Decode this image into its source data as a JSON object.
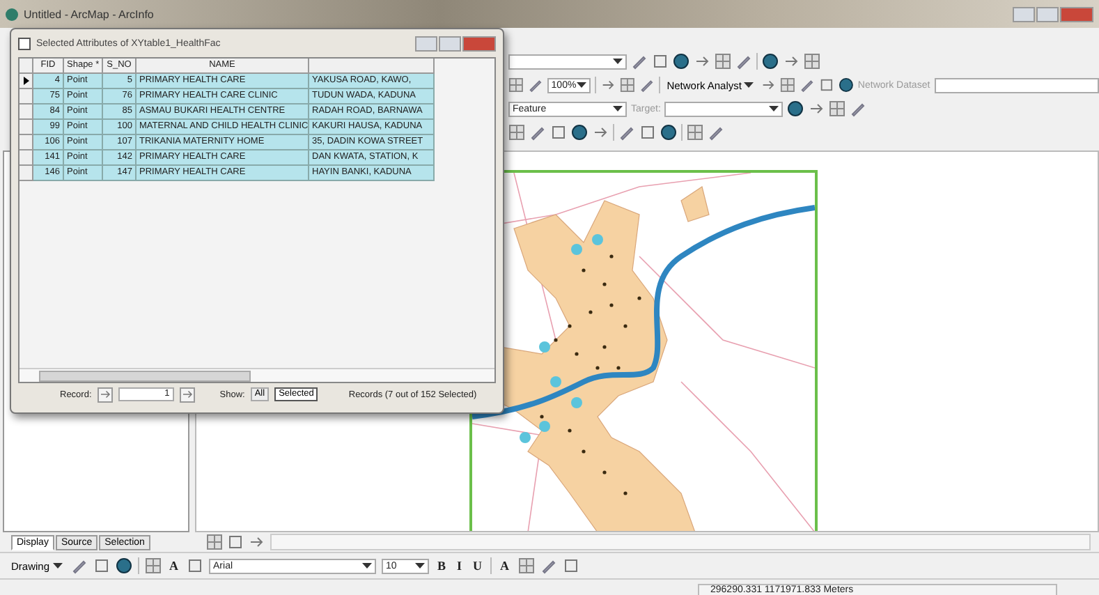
{
  "window": {
    "title": "Untitled - ArcMap - ArcInfo"
  },
  "toolbars": [
    [
      {
        "kind": "dropdown"
      },
      {
        "kind": "icon"
      },
      {
        "kind": "icon"
      },
      {
        "kind": "icon"
      },
      {
        "kind": "icon"
      },
      {
        "kind": "icon"
      },
      {
        "kind": "icon"
      },
      {
        "kind": "sep"
      },
      {
        "kind": "icon"
      },
      {
        "kind": "icon"
      },
      {
        "kind": "icon"
      }
    ],
    [
      {
        "kind": "icon"
      },
      {
        "kind": "icon"
      },
      {
        "kind": "dropdown",
        "value": "100%"
      },
      {
        "kind": "sep"
      },
      {
        "kind": "icon"
      },
      {
        "kind": "icon"
      },
      {
        "kind": "icon"
      },
      {
        "kind": "sep"
      },
      {
        "kind": "menu",
        "label": "Network Analyst"
      },
      {
        "kind": "icon"
      },
      {
        "kind": "icon"
      },
      {
        "kind": "icon"
      },
      {
        "kind": "icon"
      },
      {
        "kind": "icon"
      },
      {
        "kind": "label",
        "label": "Network Dataset"
      },
      {
        "kind": "field"
      }
    ],
    [
      {
        "kind": "dropdown",
        "value": "Feature"
      },
      {
        "kind": "label",
        "label": "Target:"
      },
      {
        "kind": "dropdown"
      },
      {
        "kind": "icon"
      },
      {
        "kind": "icon"
      },
      {
        "kind": "icon"
      },
      {
        "kind": "icon"
      }
    ],
    [
      {
        "kind": "icon"
      },
      {
        "kind": "icon"
      },
      {
        "kind": "icon"
      },
      {
        "kind": "icon"
      },
      {
        "kind": "icon"
      },
      {
        "kind": "sep"
      },
      {
        "kind": "icon"
      },
      {
        "kind": "icon"
      },
      {
        "kind": "icon"
      },
      {
        "kind": "sep"
      },
      {
        "kind": "icon"
      },
      {
        "kind": "icon"
      }
    ]
  ],
  "toc_tabs": [
    {
      "label": "Display",
      "selected": true
    },
    {
      "label": "Source",
      "selected": false
    },
    {
      "label": "Selection",
      "selected": false
    }
  ],
  "drawing_toolbar": [
    {
      "kind": "menu",
      "label": "Drawing"
    },
    {
      "kind": "icon"
    },
    {
      "kind": "icon"
    },
    {
      "kind": "icon"
    },
    {
      "kind": "sep"
    },
    {
      "kind": "icon"
    },
    {
      "kind": "text",
      "label": "A"
    },
    {
      "kind": "icon"
    },
    {
      "kind": "font_dropdown",
      "value": "Arial"
    },
    {
      "kind": "dropdown",
      "value": "10"
    },
    {
      "kind": "text",
      "label": "B"
    },
    {
      "kind": "text",
      "label": "I"
    },
    {
      "kind": "text",
      "label": "U"
    },
    {
      "kind": "sep"
    },
    {
      "kind": "text",
      "label": "A"
    },
    {
      "kind": "icon"
    },
    {
      "kind": "icon"
    },
    {
      "kind": "icon"
    }
  ],
  "status_bar": {
    "coordinates": "296290.331  1171971.833 Meters"
  },
  "dialog": {
    "title": "Selected Attributes of XYtable1_HealthFac",
    "columns": [
      "FID",
      "Shape *",
      "S_NO",
      "NAME"
    ],
    "rows": [
      {
        "cells": [
          "4",
          "Point",
          "5",
          "PRIMARY HEALTH CARE",
          "YAKUSA ROAD, KAWO,"
        ],
        "current": true,
        "selected": true
      },
      {
        "cells": [
          "75",
          "Point",
          "76",
          "PRIMARY HEALTH CARE CLINIC",
          "TUDUN WADA, KADUNA"
        ],
        "current": false,
        "selected": true
      },
      {
        "cells": [
          "84",
          "Point",
          "85",
          "ASMAU BUKARI HEALTH CENTRE",
          "RADAH ROAD, BARNAWA"
        ],
        "current": false,
        "selected": true
      },
      {
        "cells": [
          "99",
          "Point",
          "100",
          "MATERNAL AND CHILD HEALTH CLINIC",
          "KAKURI HAUSA, KADUNA"
        ],
        "current": false,
        "selected": true
      },
      {
        "cells": [
          "106",
          "Point",
          "107",
          "TRIKANIA MATERNITY HOME",
          "35, DADIN KOWA STREET"
        ],
        "current": false,
        "selected": true
      },
      {
        "cells": [
          "141",
          "Point",
          "142",
          "PRIMARY HEALTH CARE",
          "DAN KWATA, STATION, K"
        ],
        "current": false,
        "selected": true
      },
      {
        "cells": [
          "146",
          "Point",
          "147",
          "PRIMARY HEALTH CARE",
          "HAYIN BANKI, KADUNA"
        ],
        "current": false,
        "selected": true
      }
    ],
    "record_label": "Record:",
    "record_value": "1",
    "show_label": "Show:",
    "show_options": [
      {
        "label": "All",
        "selected": false
      },
      {
        "label": "Selected",
        "selected": true
      }
    ],
    "records_text": "Records (7 out of 152 Selected)"
  }
}
